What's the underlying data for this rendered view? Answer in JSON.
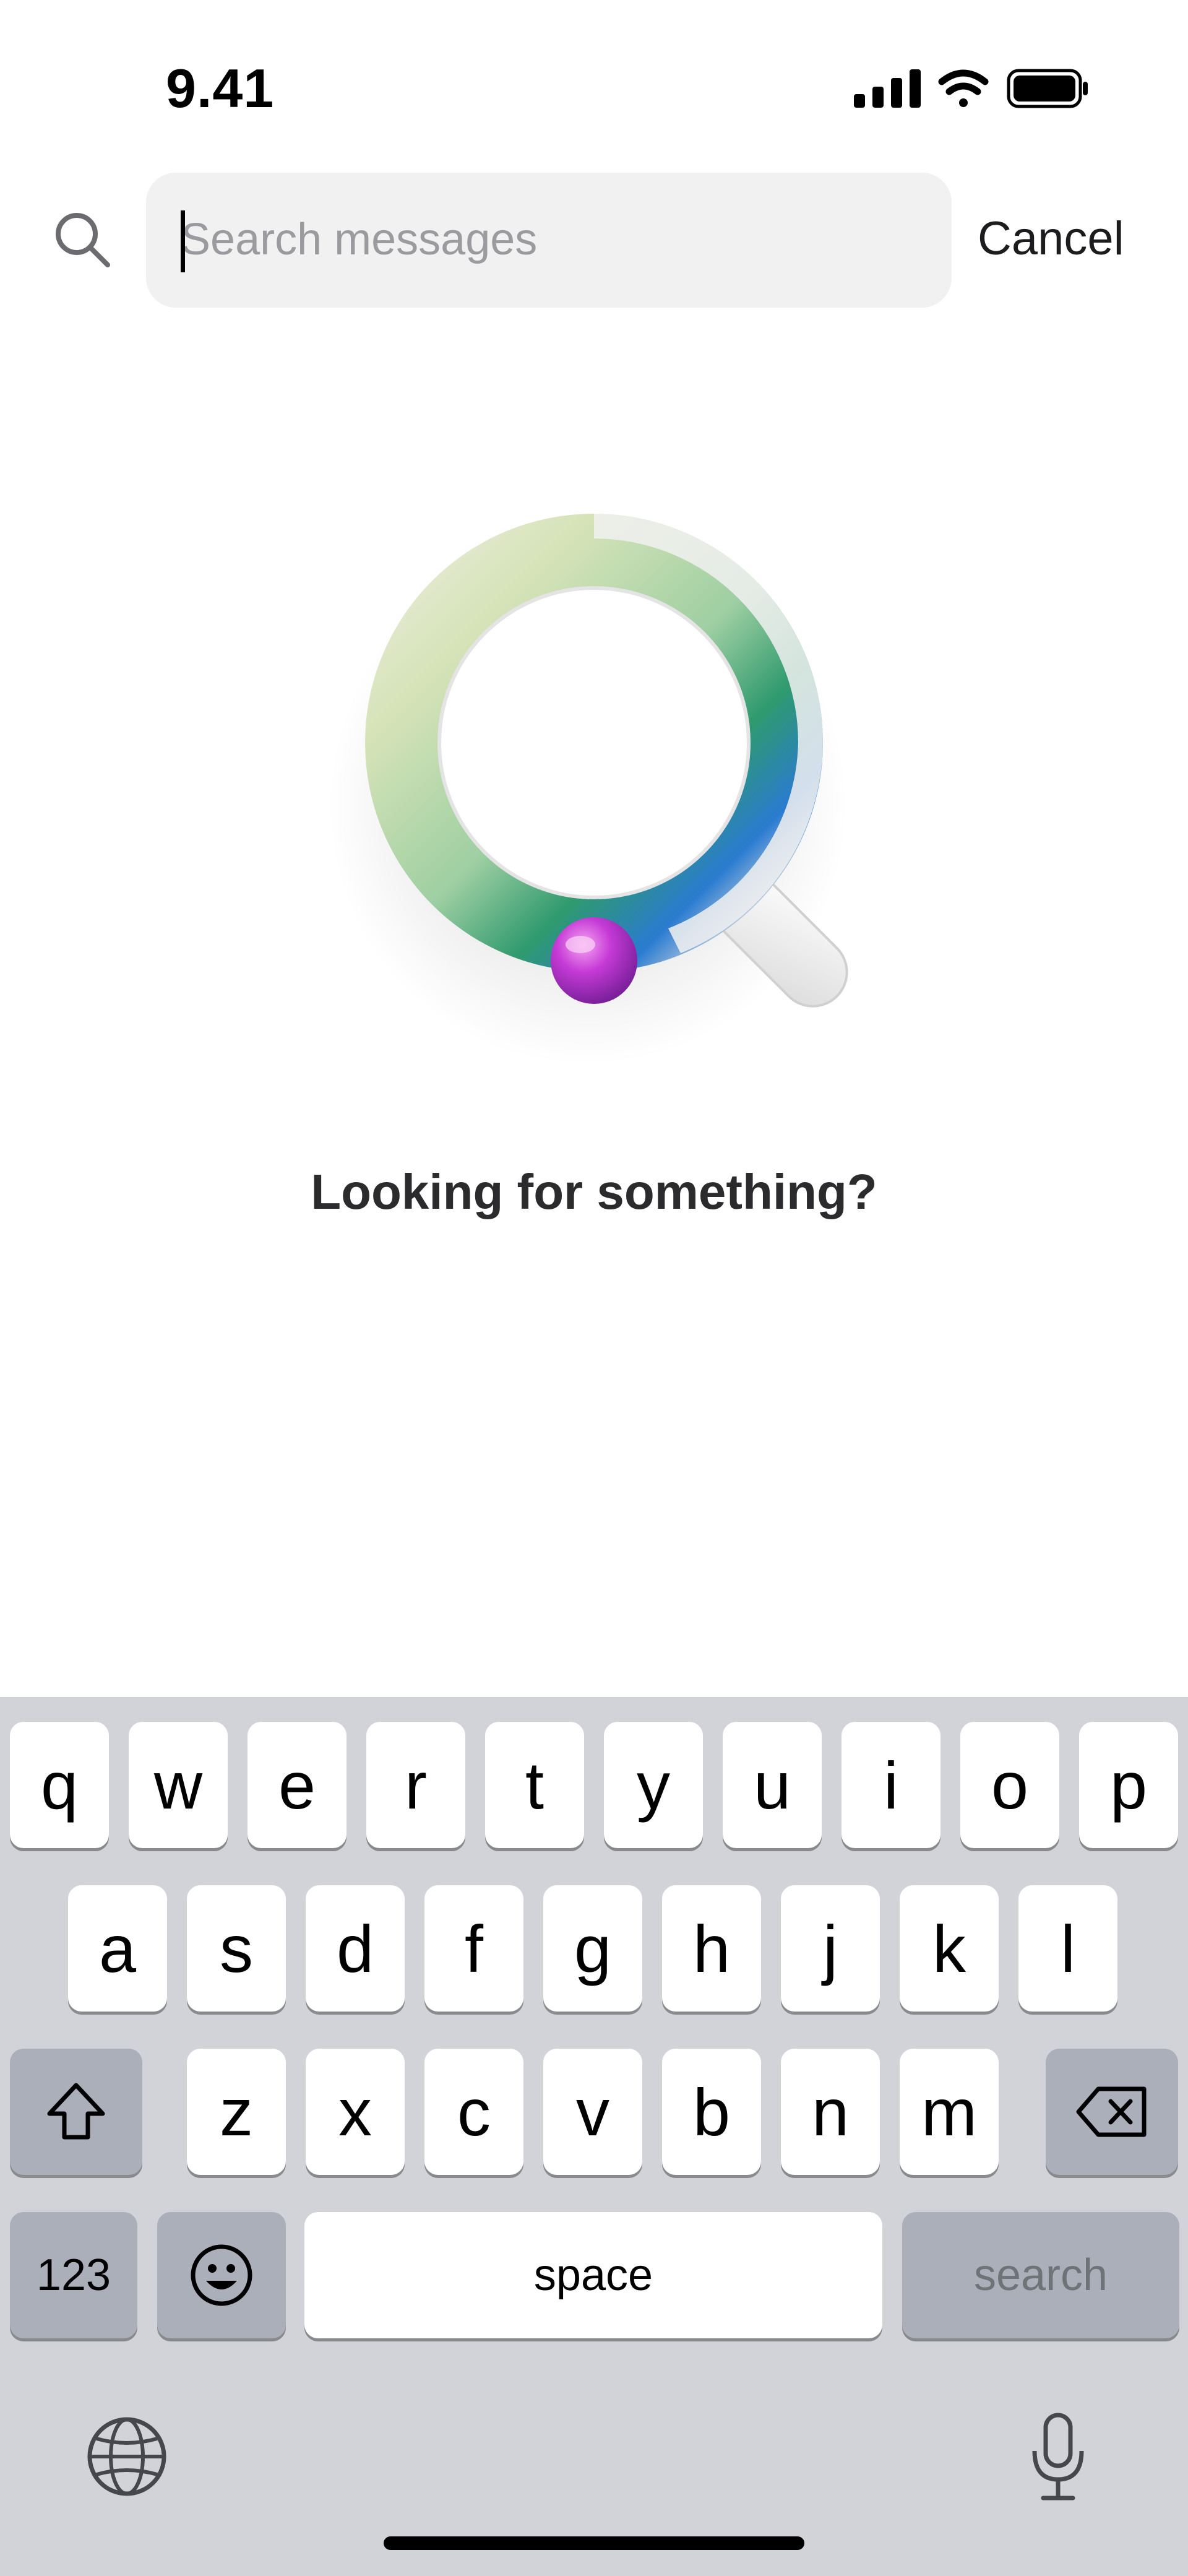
{
  "status_bar": {
    "time": "9.41"
  },
  "search": {
    "placeholder": "Search messages",
    "value": "",
    "cancel_label": "Cancel"
  },
  "empty_state": {
    "title": "Looking for something?"
  },
  "keyboard": {
    "row1": [
      "q",
      "w",
      "e",
      "r",
      "t",
      "y",
      "u",
      "i",
      "o",
      "p"
    ],
    "row2": [
      "a",
      "s",
      "d",
      "f",
      "g",
      "h",
      "j",
      "k",
      "l"
    ],
    "row3": [
      "z",
      "x",
      "c",
      "v",
      "b",
      "n",
      "m"
    ],
    "numbers_label": "123",
    "space_label": "space",
    "search_label": "search"
  },
  "icons": {
    "signal": "cellular-signal-icon",
    "wifi": "wifi-icon",
    "battery": "battery-icon",
    "search": "search-icon",
    "shift": "shift-icon",
    "backspace": "backspace-icon",
    "emoji": "emoji-icon",
    "globe": "globe-icon",
    "microphone": "microphone-icon"
  }
}
